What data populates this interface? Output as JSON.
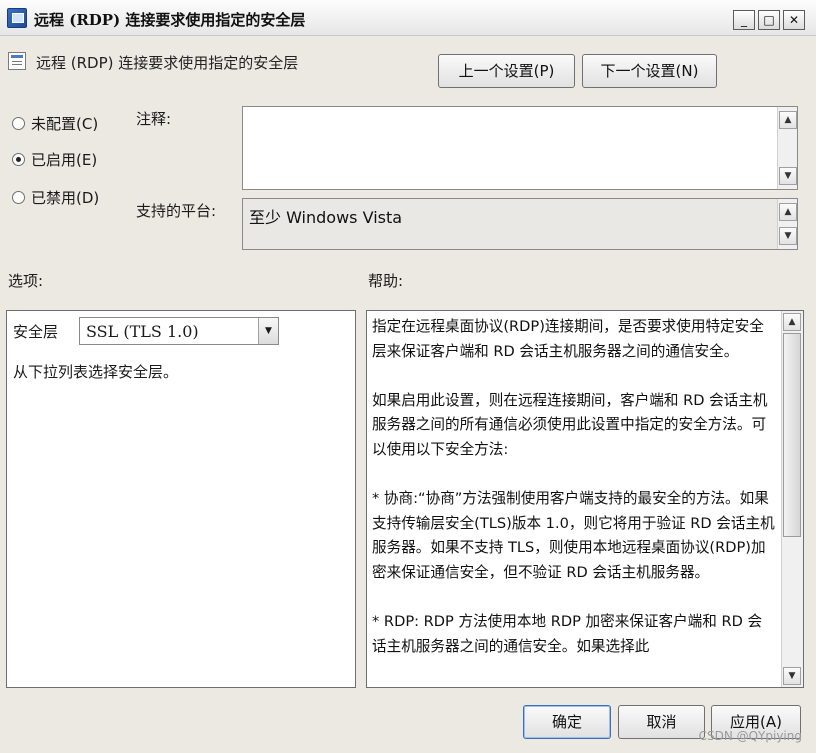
{
  "window": {
    "title": "远程 (RDP) 连接要求使用指定的安全层",
    "minimize_symbol": "_",
    "maximize_symbol": "□",
    "close_symbol": "✕"
  },
  "header": {
    "title": "远程 (RDP) 连接要求使用指定的安全层",
    "prev_button": "上一个设置(P)",
    "next_button": "下一个设置(N)"
  },
  "state": {
    "options": [
      {
        "label": "未配置(C)",
        "checked": false
      },
      {
        "label": "已启用(E)",
        "checked": true
      },
      {
        "label": "已禁用(D)",
        "checked": false
      }
    ]
  },
  "comment": {
    "label": "注释:",
    "value": ""
  },
  "platform": {
    "label": "支持的平台:",
    "value": "至少 Windows Vista"
  },
  "options_panel": {
    "label": "选项:",
    "security_layer_label": "安全层",
    "security_layer_value": "SSL (TLS 1.0)",
    "description": "从下拉列表选择安全层。"
  },
  "help_panel": {
    "label": "帮助:",
    "paragraphs": [
      "指定在远程桌面协议(RDP)连接期间，是否要求使用特定安全层来保证客户端和 RD 会话主机服务器之间的通信安全。",
      "如果启用此设置，则在远程连接期间，客户端和 RD 会话主机服务器之间的所有通信必须使用此设置中指定的安全方法。可以使用以下安全方法:",
      "* 协商:“协商”方法强制使用客户端支持的最安全的方法。如果支持传输层安全(TLS)版本 1.0，则它将用于验证 RD 会话主机服务器。如果不支持 TLS，则使用本地远程桌面协议(RDP)加密来保证通信安全，但不验证 RD 会话主机服务器。",
      "* RDP: RDP 方法使用本地 RDP 加密来保证客户端和 RD 会话主机服务器之间的通信安全。如果选择此"
    ]
  },
  "footer": {
    "ok": "确定",
    "cancel": "取消",
    "apply": "应用(A)"
  },
  "watermark": "CSDN @QYpiying",
  "icons": {
    "scroll_up": "▲",
    "scroll_down": "▼",
    "dropdown": "▼"
  }
}
